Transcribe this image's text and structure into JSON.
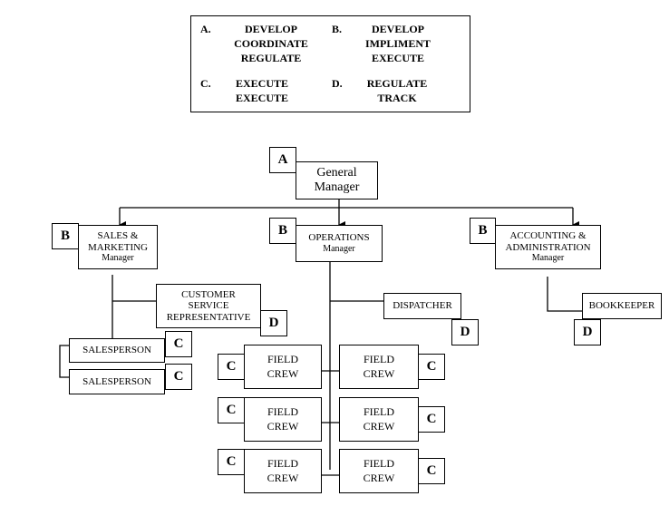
{
  "legend": {
    "A": {
      "letter": "A.",
      "lines": [
        "DEVELOP",
        "COORDINATE",
        "REGULATE"
      ]
    },
    "B": {
      "letter": "B.",
      "lines": [
        "DEVELOP",
        "IMPLIMENT",
        "EXECUTE"
      ]
    },
    "C": {
      "letter": "C.",
      "lines": [
        "EXECUTE",
        "EXECUTE"
      ]
    },
    "D": {
      "letter": "D.",
      "lines": [
        "REGULATE",
        "TRACK"
      ]
    }
  },
  "nodes": {
    "general_manager": {
      "title": "General",
      "title2": "Manager",
      "tag": "A"
    },
    "sales": {
      "title": "SALES &",
      "title2": "MARKETING",
      "sub": "Manager",
      "tag": "B"
    },
    "operations": {
      "title": "OPERATIONS",
      "sub": "Manager",
      "tag": "B"
    },
    "accounting": {
      "title": "ACCOUNTING &",
      "title2": "ADMINISTRATION",
      "sub": "Manager",
      "tag": "B"
    },
    "csr": {
      "lines": [
        "CUSTOMER",
        "SERVICE",
        "REPRESENTATIVE"
      ],
      "tag": "D"
    },
    "salesperson_1": {
      "title": "SALESPERSON",
      "tag": "C"
    },
    "salesperson_2": {
      "title": "SALESPERSON",
      "tag": "C"
    },
    "dispatcher": {
      "title": "DISPATCHER",
      "tag": "D"
    },
    "bookkeeper": {
      "title": "BOOKKEEPER",
      "tag": "D"
    },
    "field_crew": {
      "line1": "FIELD",
      "line2": "CREW",
      "tag": "C"
    }
  }
}
